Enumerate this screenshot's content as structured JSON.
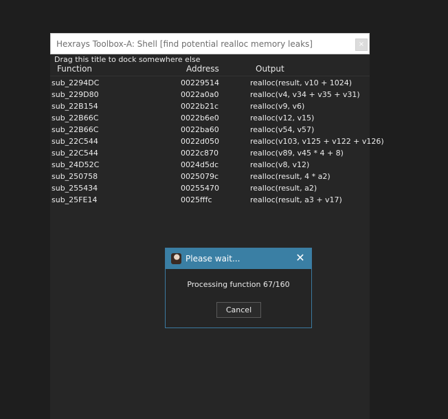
{
  "window": {
    "title": "Hexrays Toolbox-A: Shell [find potential realloc memory leaks]",
    "close_glyph": "×",
    "dock_hint": "Drag this title to dock somewhere else"
  },
  "table": {
    "columns": [
      "Function",
      "Address",
      "Output"
    ],
    "rows": [
      {
        "function": "sub_2294DC",
        "address": "00229514",
        "output": "realloc(result, v10 + 1024)"
      },
      {
        "function": "sub_229D80",
        "address": "0022a0a0",
        "output": "realloc(v4, v34 + v35 + v31)"
      },
      {
        "function": "sub_22B154",
        "address": "0022b21c",
        "output": "realloc(v9, v6)"
      },
      {
        "function": "sub_22B66C",
        "address": "0022b6e0",
        "output": "realloc(v12, v15)"
      },
      {
        "function": "sub_22B66C",
        "address": "0022ba60",
        "output": "realloc(v54, v57)"
      },
      {
        "function": "sub_22C544",
        "address": "0022d050",
        "output": "realloc(v103, v125 + v122 + v126)"
      },
      {
        "function": "sub_22C544",
        "address": "0022c870",
        "output": "realloc(v89, v45 * 4 + 8)"
      },
      {
        "function": "sub_24D52C",
        "address": "0024d5dc",
        "output": "realloc(v8, v12)"
      },
      {
        "function": "sub_250758",
        "address": "0025079c",
        "output": "realloc(result, 4 * a2)"
      },
      {
        "function": "sub_255434",
        "address": "00255470",
        "output": "realloc(result, a2)"
      },
      {
        "function": "sub_25FE14",
        "address": "0025fffc",
        "output": "realloc(result, a3 + v17)"
      }
    ]
  },
  "dialog": {
    "title": "Please wait...",
    "close_glyph": "✕",
    "message": "Processing function 67/160",
    "cancel_label": "Cancel",
    "avatar_icon": "user-avatar-icon"
  },
  "colors": {
    "accent": "#3a7fa4",
    "background": "#1e1e1e",
    "panel": "#262626"
  }
}
